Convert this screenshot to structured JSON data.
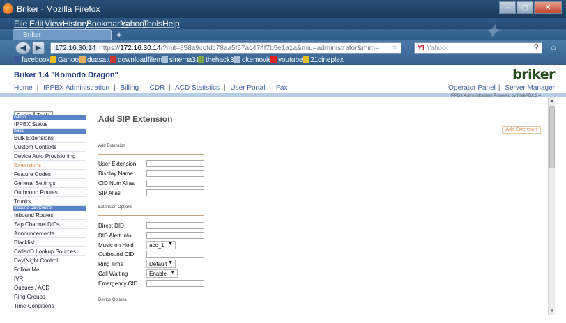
{
  "window": {
    "title": "Briker - Mozilla Firefox",
    "controls": {
      "minimize": "–",
      "restore": "▢",
      "close": "✕"
    }
  },
  "browser_menu": [
    "File",
    "Edit",
    "View",
    "History",
    "Bookmarks",
    "Yahoo!",
    "Tools",
    "Help"
  ],
  "browser_tab": {
    "label": "Briker",
    "new_tab": "+"
  },
  "address": {
    "site": "172.16.30.14",
    "scheme": "https://",
    "host": "172.16.30.14",
    "rest": "/?mit=858a9cdfdc78aa5f57ac474f7b5e1a1a&miu=administrator&mim="
  },
  "search": {
    "engine": "Y!",
    "placeholder": "Yahoo"
  },
  "bookmarks": [
    "facebook",
    "Ganool",
    "duasatu",
    "downloadfilem",
    "sinema31",
    "thehack3r",
    "okemovie",
    "youtube",
    "21cineplex"
  ],
  "bookmark_colors": [
    "#3b5998",
    "#f0c020",
    "#e0b060",
    "#cc3333",
    "#aac0d8",
    "#7aa040",
    "#aac0d8",
    "#dd2222",
    "#e8c020"
  ],
  "app": {
    "brand": "Briker 1.4 \"Komodo Dragon\"",
    "logo": "briker",
    "powered_by": "IPPBX Administration | Powered by FreePBX 2.4"
  },
  "top_nav": [
    "Home",
    "IPPBX Administration",
    "Billing",
    "CDR",
    "ACD Statistics",
    "User Portal",
    "Fax"
  ],
  "right_nav": [
    "Operator Panel",
    "Server Manager"
  ],
  "left_tabs": [
    "Setup",
    "Tools"
  ],
  "sidebar": [
    {
      "type": "section",
      "label": "Admin"
    },
    {
      "type": "item",
      "label": "IPPBX Status"
    },
    {
      "type": "section",
      "label": "Basic"
    },
    {
      "type": "item",
      "label": "Bulk Extensions"
    },
    {
      "type": "item",
      "label": "Custom Contexts"
    },
    {
      "type": "item",
      "label": "Device Auto Provisioning"
    },
    {
      "type": "item",
      "label": "Extensions",
      "active": true
    },
    {
      "type": "item",
      "label": "Feature Codes"
    },
    {
      "type": "item",
      "label": "General Settings"
    },
    {
      "type": "item",
      "label": "Outbound Routes"
    },
    {
      "type": "item",
      "label": "Trunks"
    },
    {
      "type": "section",
      "label": "Inbound Call Control"
    },
    {
      "type": "item",
      "label": "Inbound Routes"
    },
    {
      "type": "item",
      "label": "Zap Channel DIDs"
    },
    {
      "type": "item",
      "label": "Announcements"
    },
    {
      "type": "item",
      "label": "Blacklist"
    },
    {
      "type": "item",
      "label": "CallerID Lookup Sources"
    },
    {
      "type": "item",
      "label": "Day/Night Control"
    },
    {
      "type": "item",
      "label": "Follow Me"
    },
    {
      "type": "item",
      "label": "IVR"
    },
    {
      "type": "item",
      "label": "Queues / ACD"
    },
    {
      "type": "item",
      "label": "Ring Groups"
    },
    {
      "type": "item",
      "label": "Time Conditions"
    }
  ],
  "form": {
    "title": "Add SIP Extension",
    "add_button": "Add Extension",
    "sections": {
      "add_extension": "Add Extension",
      "extension_options": "Extension Options",
      "device_options": "Device Options"
    },
    "fields": {
      "user_extension": "User Extension",
      "display_name": "Display Name",
      "cid_num_alias": "CID Num Alias",
      "sip_alias": "SIP Alias",
      "direct_did": "Direct DID",
      "did_alert_info": "DID Alert Info",
      "music_on_hold": "Music on Hold",
      "outbound_cid": "Outbound CID",
      "ring_time": "Ring Time",
      "call_waiting": "Call Waiting",
      "emergency_cid": "Emergency CID"
    },
    "values": {
      "music_on_hold": "acc_1",
      "ring_time": "Default",
      "call_waiting": "Enable"
    }
  }
}
